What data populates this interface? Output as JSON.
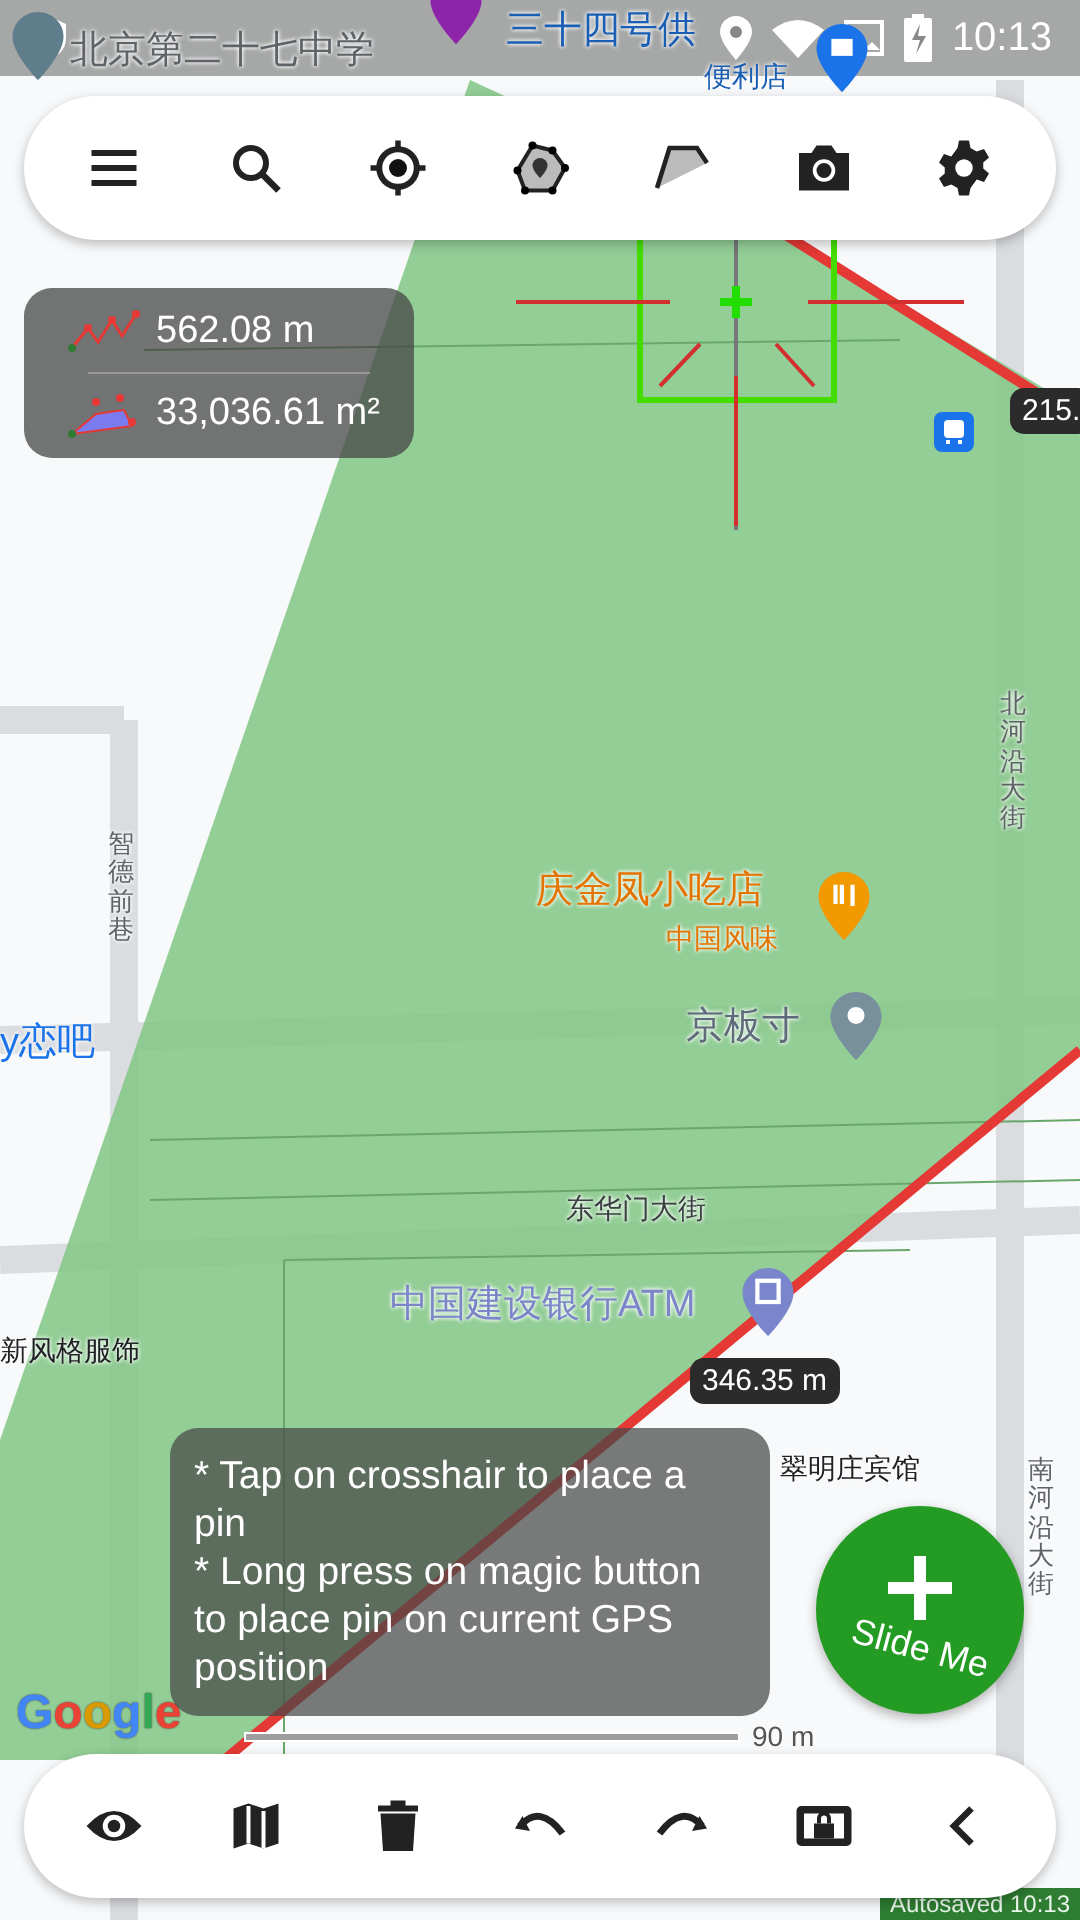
{
  "status_bar": {
    "time": "10:13"
  },
  "measurements": {
    "distance": "562.08 m",
    "area": "33,036.61 m²"
  },
  "map_labels": [
    {
      "text": "北京第二十七中学",
      "kind": "title",
      "color": "#5f6368"
    },
    {
      "text": "三十四号供",
      "kind": "title",
      "color": "#1a5fb4"
    },
    {
      "text": "便利店",
      "kind": "subtitle",
      "color": "#1a5fb4"
    },
    {
      "text": "北河沿大街",
      "kind": "vertical",
      "color": "#5f6368"
    },
    {
      "text": "智德前巷",
      "kind": "vertical",
      "color": "#5f6368"
    },
    {
      "text": "y恋吧",
      "kind": "title",
      "color": "#1a73e8"
    },
    {
      "text": "庆金凤小吃店",
      "kind": "title",
      "color": "#e37400"
    },
    {
      "text": "中国风味",
      "kind": "subtitle",
      "color": "#e37400"
    },
    {
      "text": "京板寸",
      "kind": "title",
      "color": "#5f6b7a"
    },
    {
      "text": "东华门大街",
      "kind": "subtitle",
      "color": "#3c4043"
    },
    {
      "text": "中国建设银行ATM",
      "kind": "title",
      "color": "#7b86c9"
    },
    {
      "text": "新风格服饰",
      "kind": "subtitle",
      "color": "#202124"
    },
    {
      "text": "翠明庄宾馆",
      "kind": "subtitle",
      "color": "#202124"
    },
    {
      "text": "南河沿大街",
      "kind": "vertical",
      "color": "#5f6368"
    }
  ],
  "distance_labels": [
    "215.",
    "346.35 m"
  ],
  "scale_bar": {
    "label": "90 m"
  },
  "map_attribution": "Google",
  "hint": [
    "* Tap on crosshair to place a pin",
    "* Long press on magic button to place pin on current GPS position"
  ],
  "slide_button": {
    "label": "Slide Me"
  },
  "autosave": "Autosaved 10:13"
}
